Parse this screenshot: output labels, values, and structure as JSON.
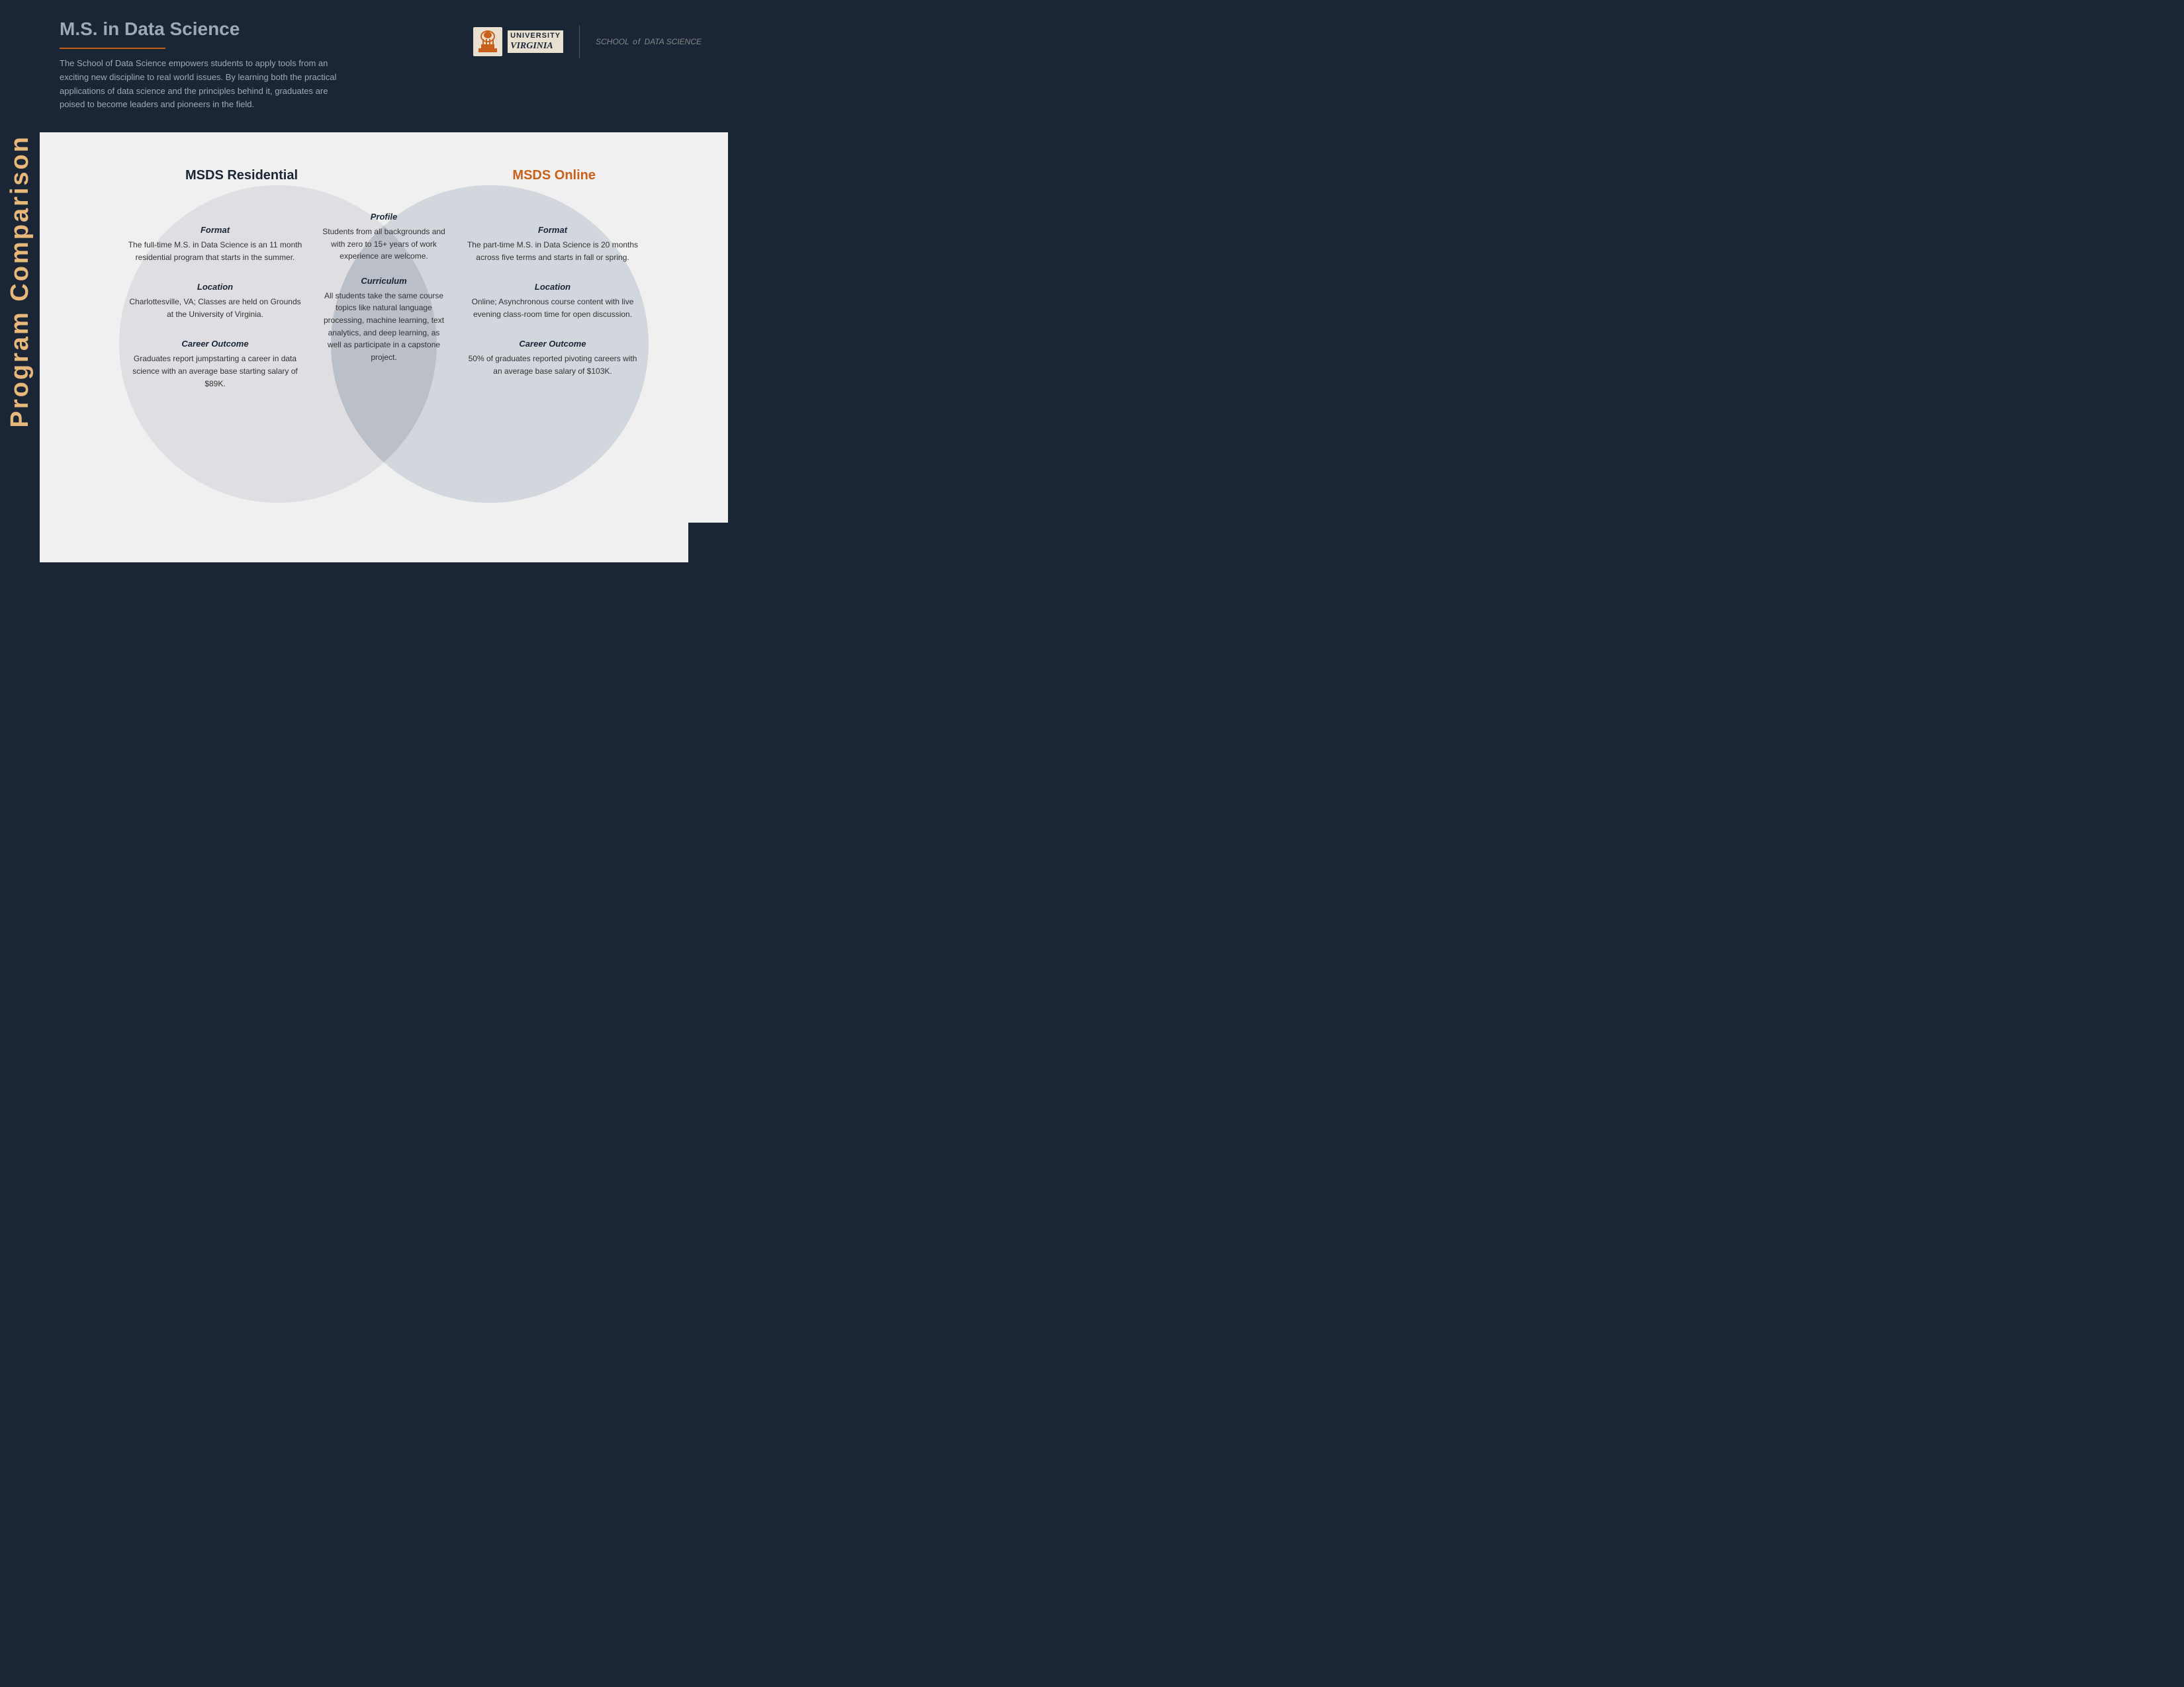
{
  "side_banner": {
    "text": "Program Comparison"
  },
  "header": {
    "title": "M.S. in Data Science",
    "description": "The School of Data Science empowers students to apply tools from an exciting new discipline to real world issues. By learning both the practical applications of data science and the principles behind it, graduates are poised to become leaders and pioneers in the field.",
    "underline_color": "#c8601a"
  },
  "logo": {
    "university_label": "UNIVERSITY",
    "virginia_label": "VIRGINIA",
    "sds_prefix": "SCHOOL",
    "sds_of": "of",
    "sds_suffix": "DATA SCIENCE"
  },
  "venn": {
    "left_label": "MSDS Residential",
    "right_label": "MSDS Online",
    "left": {
      "format_title": "Format",
      "format_text": "The full-time M.S. in Data Science is an 11 month residential program that starts in the summer.",
      "location_title": "Location",
      "location_text": "Charlottesville, VA; Classes are held on Grounds at the University of Virginia.",
      "career_title": "Career Outcome",
      "career_text": "Graduates report jumpstarting a career in data science with an average base starting salary of $89K."
    },
    "center": {
      "profile_title": "Profile",
      "profile_text": "Students from all backgrounds and with zero to 15+ years of work experience are welcome.",
      "curriculum_title": "Curriculum",
      "curriculum_text": "All students take the same course topics like natural language processing, machine learning, text analytics, and deep learning, as well as participate in a capstone project."
    },
    "right": {
      "format_title": "Format",
      "format_text": "The part-time M.S. in Data Science is 20 months across five terms and starts in fall or spring.",
      "location_title": "Location",
      "location_text": "Online; Asynchronous course content with live evening class-room time for open discussion.",
      "career_title": "Career Outcome",
      "career_text": "50% of graduates reported pivoting careers with an average base salary of $103K."
    }
  }
}
